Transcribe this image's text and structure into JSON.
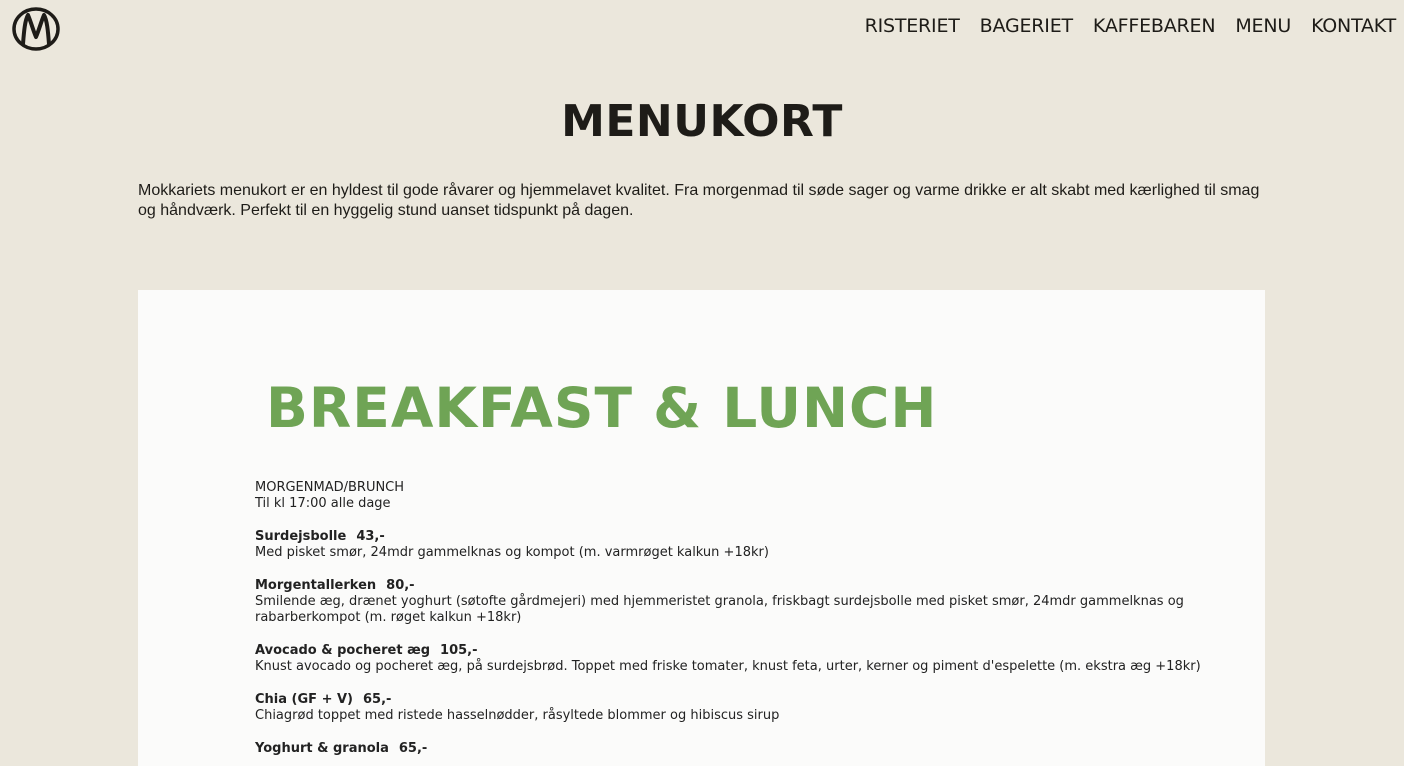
{
  "header": {
    "nav": [
      "RISTERIET",
      "BAGERIET",
      "KAFFEBAREN",
      "MENU",
      "KONTAKT"
    ]
  },
  "main": {
    "title": "MENUKORT",
    "intro": "Mokkariets menukort er en hyldest til gode råvarer og hjemmelavet kvalitet. Fra morgenmad til søde sager og varme drikke er alt skabt med kærlighed til smag og håndværk. Perfekt til en hyggelig stund uanset tidspunkt på dagen."
  },
  "menu_card": {
    "heading": "BREAKFAST & LUNCH",
    "section_title": "MORGENMAD/BRUNCH",
    "section_subtitle": "Til kl 17:00 alle dage",
    "items": [
      {
        "name": "Surdejsbolle",
        "price": "43,-",
        "description": "Med pisket smør, 24mdr gammelknas og kompot (m. varmrøget kalkun +18kr)"
      },
      {
        "name": "Morgentallerken",
        "price": "80,-",
        "description": "Smilende æg, drænet yoghurt (søtofte gårdmejeri) med hjemmeristet granola, friskbagt surdejsbolle med pisket smør, 24mdr gammelknas og rabarberkompot (m. røget kalkun +18kr)"
      },
      {
        "name": "Avocado & pocheret æg",
        "price": "105,-",
        "description": "Knust avocado og pocheret æg, på surdejsbrød. Toppet med friske tomater, knust feta, urter, kerner og piment d'espelette (m. ekstra æg +18kr)"
      },
      {
        "name": "Chia (GF + V)",
        "price": "65,-",
        "description": "Chiagrød toppet med ristede hasselnødder, råsyltede blommer og hibiscus sirup"
      },
      {
        "name": "Yoghurt & granola",
        "price": "65,-",
        "description": ""
      }
    ]
  }
}
